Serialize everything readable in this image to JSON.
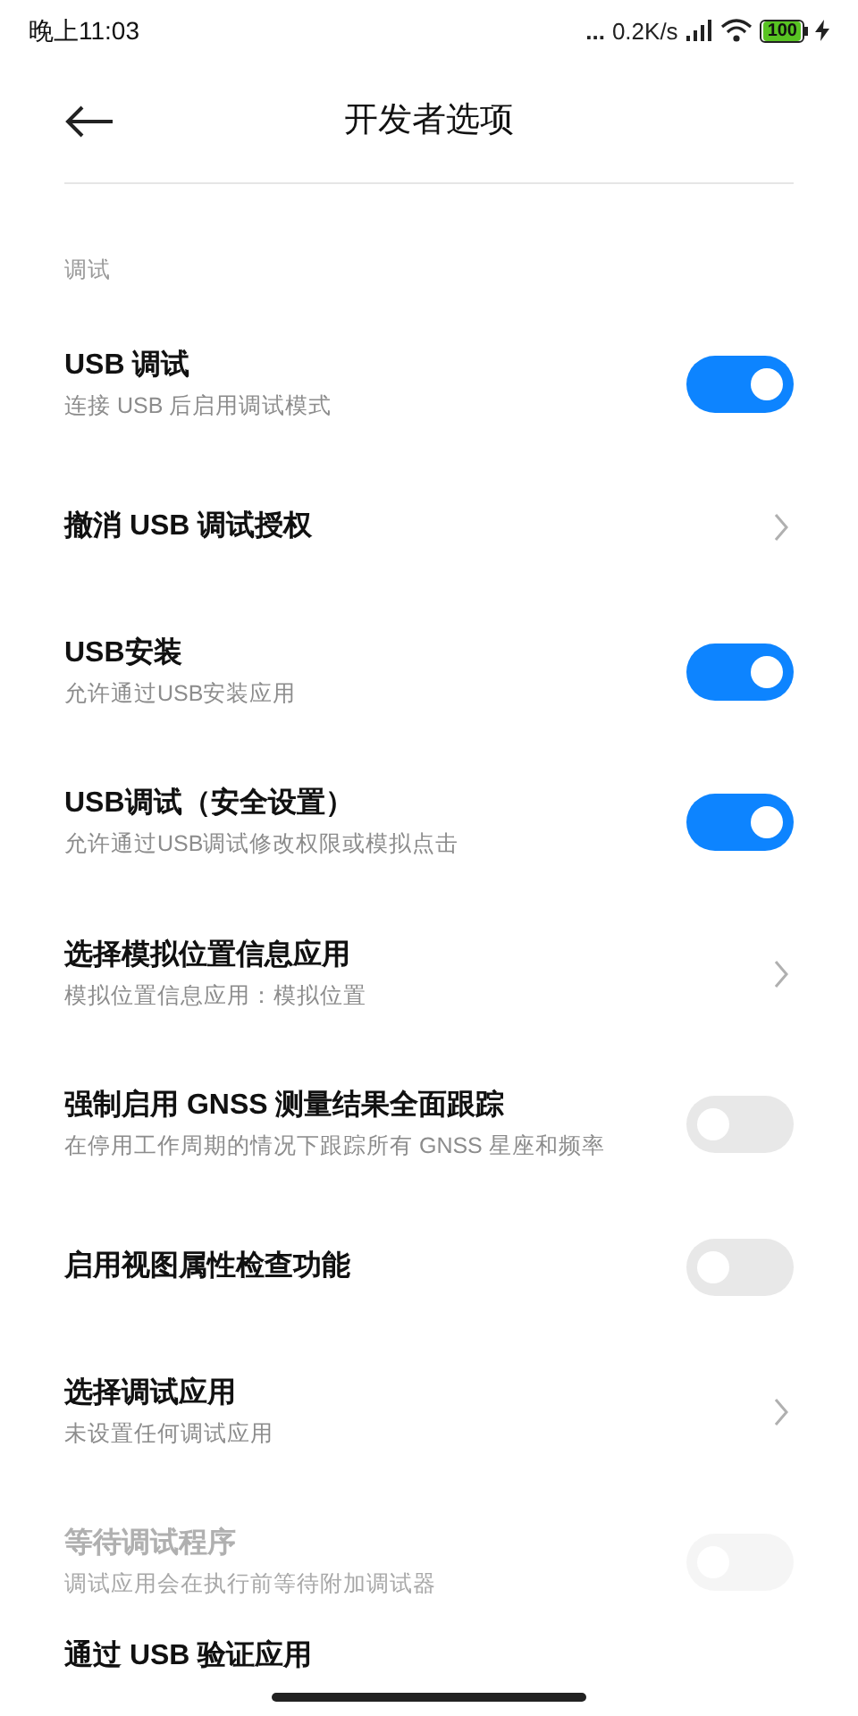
{
  "status_bar": {
    "time": "晚上11:03",
    "dots": "...",
    "net_speed": "0.2K/s",
    "battery": "100"
  },
  "header": {
    "title": "开发者选项"
  },
  "section": {
    "title": "调试"
  },
  "items": [
    {
      "kind": "toggle",
      "title": "USB 调试",
      "subtitle": "连接 USB 后启用调试模式",
      "on": true
    },
    {
      "kind": "link",
      "title": "撤消 USB 调试授权"
    },
    {
      "kind": "toggle",
      "title": "USB安装",
      "subtitle": "允许通过USB安装应用",
      "on": true
    },
    {
      "kind": "toggle",
      "title": "USB调试（安全设置）",
      "subtitle": "允许通过USB调试修改权限或模拟点击",
      "on": true
    },
    {
      "kind": "link",
      "title": "选择模拟位置信息应用",
      "subtitle": "模拟位置信息应用：模拟位置"
    },
    {
      "kind": "toggle",
      "title": "强制启用 GNSS 测量结果全面跟踪",
      "subtitle": "在停用工作周期的情况下跟踪所有 GNSS 星座和频率",
      "on": false
    },
    {
      "kind": "toggle",
      "title": "启用视图属性检查功能",
      "on": false
    },
    {
      "kind": "link",
      "title": "选择调试应用",
      "subtitle": "未设置任何调试应用"
    },
    {
      "kind": "toggle",
      "title": "等待调试程序",
      "subtitle": "调试应用会在执行前等待附加调试器",
      "on": false,
      "disabled": true
    },
    {
      "title": "通过 USB 验证应用"
    }
  ]
}
